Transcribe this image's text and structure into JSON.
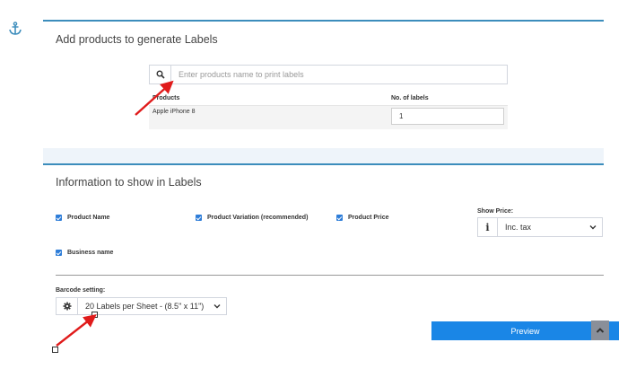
{
  "side_icon": "anchor-icon",
  "labels_panel": {
    "title": "Add products to generate Labels",
    "search": {
      "placeholder": "Enter products name to print labels",
      "value": "",
      "icon": "search-icon"
    },
    "table": {
      "headers": [
        "Products",
        "No. of labels"
      ],
      "rows": [
        {
          "product": "Apple iPhone 8",
          "quantity": "1"
        }
      ]
    }
  },
  "info_panel": {
    "title": "Information to show in Labels",
    "checkboxes": [
      {
        "label": "Product Name",
        "checked": true
      },
      {
        "label": "Product Variation (recommended)",
        "checked": true
      },
      {
        "label": "Product Price",
        "checked": true
      },
      {
        "label": "Business name",
        "checked": true
      }
    ],
    "show_price": {
      "label": "Show Price:",
      "icon": "info-icon",
      "selected": "Inc. tax"
    },
    "barcode": {
      "label": "Barcode setting:",
      "icon": "gear-icon",
      "selected": "20 Labels per Sheet - (8.5\" x 11\")"
    },
    "preview_label": "Preview",
    "scroll_top_icon": "chevron-up-icon"
  },
  "colors": {
    "accent": "#3c8dbc",
    "button": "#1a86e6",
    "annotation_arrow": "#e01b1b"
  }
}
